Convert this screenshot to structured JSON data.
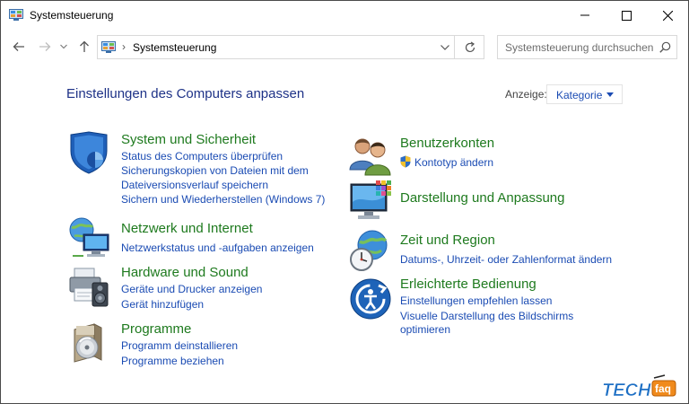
{
  "window": {
    "title": "Systemsteuerung",
    "controls": [
      "minimize",
      "maximize",
      "close"
    ]
  },
  "navigation": {
    "breadcrumb": [
      "Systemsteuerung"
    ],
    "search_placeholder": "Systemsteuerung durchsuchen"
  },
  "main": {
    "heading": "Einstellungen des Computers anpassen",
    "view_label": "Anzeige:",
    "view_value": "Kategorie"
  },
  "categories": {
    "system": {
      "title": "System und Sicherheit",
      "icon": "shield-icon",
      "links": [
        "Status des Computers überprüfen",
        "Sicherungskopien von Dateien mit dem",
        "Dateiversionsverlauf speichern",
        "Sichern und Wiederherstellen (Windows 7)"
      ]
    },
    "network": {
      "title": "Netzwerk und Internet",
      "icon": "network-globe-icon",
      "links": [
        "Netzwerkstatus und -aufgaben anzeigen"
      ]
    },
    "hardware": {
      "title": "Hardware und Sound",
      "icon": "printer-speaker-icon",
      "links": [
        "Geräte und Drucker anzeigen",
        "Gerät hinzufügen"
      ]
    },
    "programs": {
      "title": "Programme",
      "icon": "programs-disc-icon",
      "links": [
        "Programm deinstallieren",
        "Programme beziehen"
      ]
    },
    "accounts": {
      "title": "Benutzerkonten",
      "icon": "users-icon",
      "links": [
        "Kontotyp ändern"
      ]
    },
    "appearance": {
      "title": "Darstellung und Anpassung",
      "icon": "display-palette-icon",
      "links": []
    },
    "region": {
      "title": "Zeit und Region",
      "icon": "globe-clock-icon",
      "links": [
        "Datums-, Uhrzeit- oder Zahlenformat ändern"
      ]
    },
    "access": {
      "title": "Erleichterte Bedienung",
      "icon": "ease-of-access-icon",
      "links": [
        "Einstellungen empfehlen lassen",
        "Visuelle Darstellung des Bildschirms",
        "optimieren"
      ]
    }
  },
  "watermark": {
    "text_main": "TECH",
    "text_badge": "faq"
  },
  "colors": {
    "heading_blue": "#1e3287",
    "category_green": "#1e7a1e",
    "link_blue": "#1a4bb3",
    "border": "#4a4a4a"
  }
}
